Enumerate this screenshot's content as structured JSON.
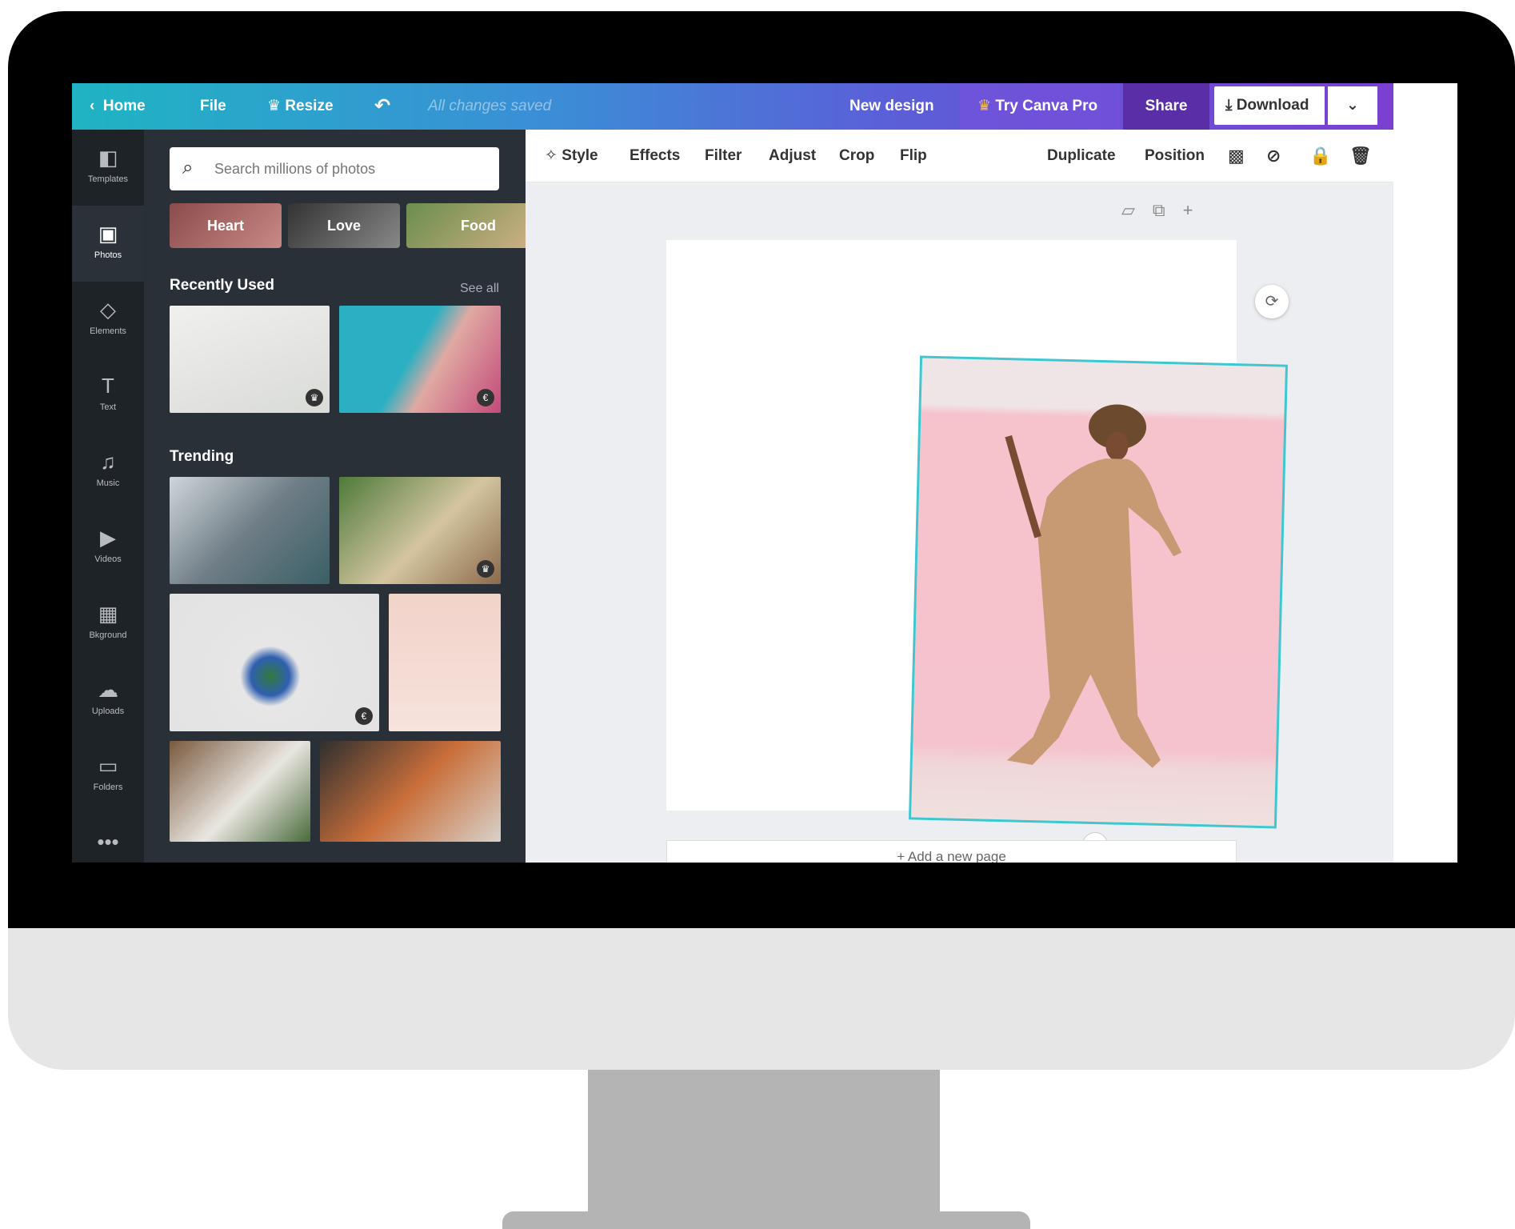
{
  "topbar": {
    "home": "Home",
    "file": "File",
    "resize": "Resize",
    "saved": "All changes saved",
    "new_design": "New design",
    "try_pro": "Try Canva Pro",
    "share": "Share",
    "download": "Download"
  },
  "rail": [
    {
      "label": "Templates",
      "icon": "templates-icon",
      "glyph": "◧"
    },
    {
      "label": "Photos",
      "icon": "photos-icon",
      "glyph": "▣"
    },
    {
      "label": "Elements",
      "icon": "elements-icon",
      "glyph": "◇"
    },
    {
      "label": "Text",
      "icon": "text-icon",
      "glyph": "T"
    },
    {
      "label": "Music",
      "icon": "music-icon",
      "glyph": "♫"
    },
    {
      "label": "Videos",
      "icon": "videos-icon",
      "glyph": "▶"
    },
    {
      "label": "Bkground",
      "icon": "background-icon",
      "glyph": "▦"
    },
    {
      "label": "Uploads",
      "icon": "uploads-icon",
      "glyph": "☁"
    },
    {
      "label": "Folders",
      "icon": "folders-icon",
      "glyph": "▭"
    },
    {
      "label": "",
      "icon": "more-icon",
      "glyph": "•••"
    }
  ],
  "panel": {
    "search_placeholder": "Search millions of photos",
    "chips": [
      "Heart",
      "Love",
      "Food"
    ],
    "recently_used": "Recently Used",
    "see_all": "See all",
    "trending": "Trending"
  },
  "toolbar": {
    "items": [
      "Style",
      "Effects",
      "Filter",
      "Adjust",
      "Crop",
      "Flip"
    ],
    "duplicate": "Duplicate",
    "position": "Position"
  },
  "canvas": {
    "add_page": "+ Add a new page"
  },
  "colors": {
    "accent": "#3fc7d0",
    "share_bg": "#5a2ea6",
    "panel_bg": "#2a3037"
  }
}
